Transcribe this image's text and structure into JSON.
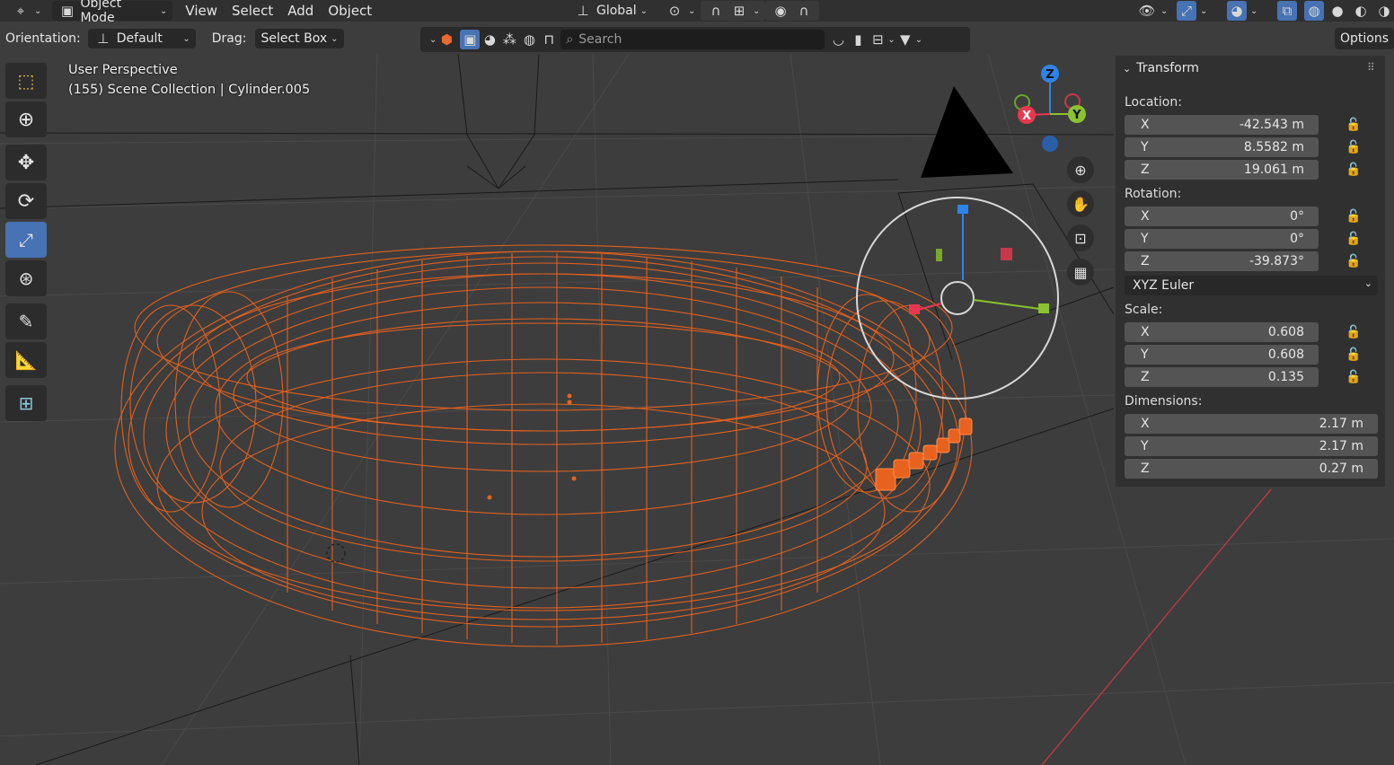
{
  "header": {
    "mode": "Object Mode",
    "menus": [
      "View",
      "Select",
      "Add",
      "Object"
    ],
    "transform_orientation": "Global"
  },
  "tool_header": {
    "orientation_label": "Orientation:",
    "orientation_value": "Default",
    "drag_label": "Drag:",
    "drag_value": "Select Box",
    "search_placeholder": "Search",
    "options_label": "Options"
  },
  "viewport": {
    "view_name": "User Perspective",
    "collection_info": "(155) Scene Collection | Cylinder.005",
    "gizmo_axes": {
      "x": "X",
      "y": "Y",
      "z": "Z"
    }
  },
  "npanel": {
    "title": "Transform",
    "location_label": "Location:",
    "location": {
      "x": "-42.543 m",
      "y": "8.5582 m",
      "z": "19.061 m"
    },
    "rotation_label": "Rotation:",
    "rotation": {
      "x": "0°",
      "y": "0°",
      "z": "-39.873°"
    },
    "rotation_mode": "XYZ Euler",
    "scale_label": "Scale:",
    "scale": {
      "x": "0.608",
      "y": "0.608",
      "z": "0.135"
    },
    "dimensions_label": "Dimensions:",
    "dimensions": {
      "x": "2.17 m",
      "y": "2.17 m",
      "z": "0.27 m"
    },
    "axis_labels": {
      "x": "X",
      "y": "Y",
      "z": "Z"
    }
  },
  "colors": {
    "selection_orange": "#e8621f",
    "active_tool_blue": "#4772b3",
    "axis_x": "#e8384f",
    "axis_y": "#8bc22f",
    "axis_z": "#2f83e8"
  }
}
